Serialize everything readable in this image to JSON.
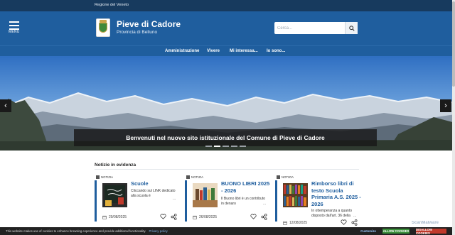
{
  "topbar": {
    "region_link": "Regione del Veneto"
  },
  "header": {
    "menu_label": "MENU",
    "title": "Pieve di Cadore",
    "subtitle": "Provincia di Belluno",
    "search_placeholder": "Cerca...",
    "brand_color": "#1f5e9e",
    "dark_color": "#173a5e"
  },
  "nav": {
    "items": [
      "Amministrazione",
      "Vivere",
      "Mi interessa...",
      "Io sono..."
    ]
  },
  "hero": {
    "caption": "Benvenuti nel nuovo sito istituzionale del Comune di Pieve di Cadore",
    "prev_arrow": "‹",
    "next_arrow": "›",
    "slide_count": 5,
    "active_slide": 1
  },
  "news": {
    "section_title": "Notizie in evidenza",
    "cards": [
      {
        "category": "NOTIZIA",
        "title": "Scuole",
        "text": "Cliccando sul LINK dedicato alla scuola è",
        "ellipsis": "...",
        "date": "29/08/2025"
      },
      {
        "category": "NOTIZIA",
        "title": "BUONO LIBRI 2025 - 2026",
        "text": "Il Buono libri è un contributo in denaro",
        "ellipsis": "...",
        "date": "26/08/2025"
      },
      {
        "category": "NOTIZIA",
        "title": "Rimborso libri di testo Scuola Primaria A.S. 2025 - 2026",
        "text": "In ottemperanza a quanto disposto dall'art. 36 della",
        "ellipsis": "...",
        "date": "12/08/2025"
      }
    ]
  },
  "cookie": {
    "text": "This website makes use of cookies to enhance browsing experience and provide additional functionality.",
    "privacy_link": "Privacy policy",
    "customize": "Customize",
    "allow": "ALLOW COOKIES",
    "disallow": "DISALLOW COOKIES"
  },
  "watermark": "ScanMalware"
}
